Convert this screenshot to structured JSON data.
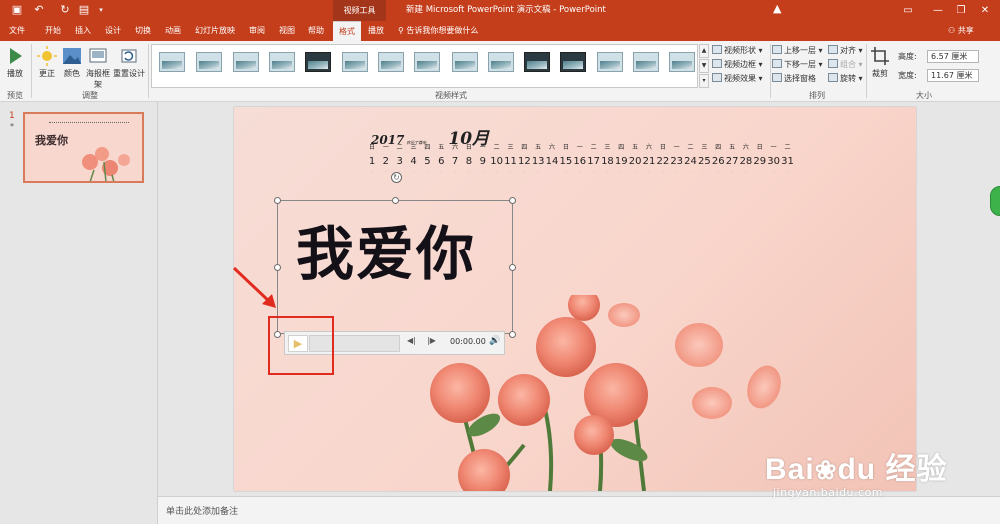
{
  "window": {
    "contextual_tab_group": "视频工具",
    "document_title": "新建 Microsoft PowerPoint 演示文稿 - PowerPoint"
  },
  "tabs": [
    "文件",
    "开始",
    "插入",
    "设计",
    "切换",
    "动画",
    "幻灯片放映",
    "审阅",
    "视图",
    "帮助",
    "格式",
    "播放"
  ],
  "active_tab": "格式",
  "tell_me": "告诉我你想要做什么",
  "share": "共享",
  "ribbon": {
    "play_button": "播放",
    "preview_group": "预览",
    "correct_button": "更正",
    "color_button": "颜色",
    "poster_frame_button": "海报框架",
    "reset_design_button": "重置设计",
    "adjust_group": "调整",
    "video_styles_group": "视频样式",
    "video_shape": "视频形状",
    "video_border": "视频边框",
    "video_effects": "视频效果",
    "bring_forward": "上移一层",
    "send_backward": "下移一层",
    "selection_pane": "选择窗格",
    "align": "对齐",
    "group": "组合",
    "rotate": "旋转",
    "arrange_group": "排列",
    "crop_button": "裁剪",
    "height_label": "高度:",
    "height_value": "6.57 厘米",
    "width_label": "宽度:",
    "width_value": "11.67 厘米",
    "size_group": "大小"
  },
  "thumbnails": {
    "slide_number": "1",
    "slide_marker": "*",
    "slide_title": "我爱你"
  },
  "slide": {
    "year": "2017",
    "small_caption": "农历丁酉年",
    "month": "10月",
    "weekdays": [
      "日",
      "一",
      "二",
      "三",
      "四",
      "五",
      "六",
      "日",
      "一",
      "二",
      "三",
      "四",
      "五",
      "六",
      "日",
      "一",
      "二",
      "三",
      "四",
      "五",
      "六",
      "日",
      "一",
      "二",
      "三",
      "四",
      "五",
      "六",
      "日",
      "一",
      "二"
    ],
    "days": [
      "1",
      "2",
      "3",
      "4",
      "5",
      "6",
      "7",
      "8",
      "9",
      "10",
      "11",
      "12",
      "13",
      "14",
      "15",
      "16",
      "17",
      "18",
      "19",
      "20",
      "21",
      "22",
      "23",
      "24",
      "25",
      "26",
      "27",
      "28",
      "29",
      "30",
      "31"
    ],
    "main_text": "我爱你",
    "player_time": "00:00.00"
  },
  "notes_placeholder": "单击此处添加备注",
  "watermark": {
    "main": "Bai",
    "paw": "du",
    "cn": "经验",
    "url": "jingyan.baidu.com"
  },
  "colors": {
    "accent": "#c43e1c",
    "highlight_box": "#e12b1f"
  }
}
